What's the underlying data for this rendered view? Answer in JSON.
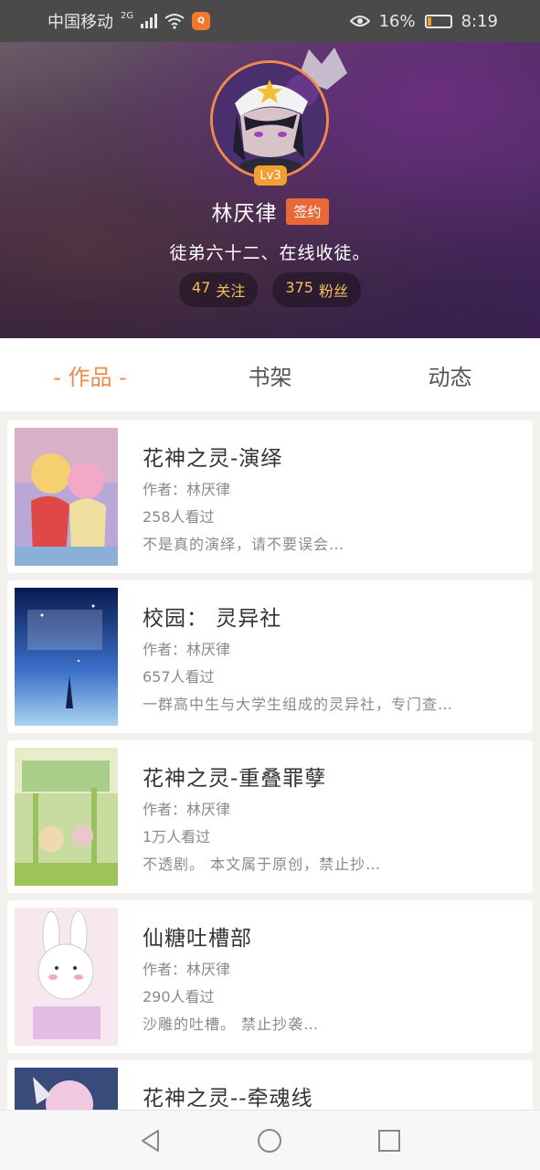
{
  "status_bar": {
    "carrier": "中国移动",
    "network": "2G",
    "battery_percent": "16%",
    "battery_level": 0.16,
    "time": "8:19"
  },
  "profile": {
    "level": "Lv3",
    "name": "林厌律",
    "sign_badge": "签约",
    "bio": "徒弟六十二、在线收徒。",
    "following_count": "47",
    "following_label": "关注",
    "fans_count": "375",
    "fans_label": "粉丝"
  },
  "tabs": [
    {
      "label": "- 作品 -",
      "active": true
    },
    {
      "label": "书架",
      "active": false
    },
    {
      "label": "动态",
      "active": false
    }
  ],
  "books": [
    {
      "title": "花神之灵-演绎",
      "author": "作者：林厌律",
      "views": "258人看过",
      "desc": "不是真的演绎，请不要误会…"
    },
    {
      "title": "校园： 灵异社",
      "author": "作者：林厌律",
      "views": "657人看过",
      "desc": "一群高中生与大学生组成的灵异社，专门查…"
    },
    {
      "title": "花神之灵-重叠罪孽",
      "author": "作者：林厌律",
      "views": "1万人看过",
      "desc": "不透剧。 本文属于原创，禁止抄…"
    },
    {
      "title": "仙糖吐槽部",
      "author": "作者：林厌律",
      "views": "290人看过",
      "desc": "沙雕的吐槽。 禁止抄袭…"
    },
    {
      "title": "花神之灵--牵魂线",
      "author": "",
      "views": "",
      "desc": ""
    }
  ],
  "colors": {
    "accent": "#f08a4a",
    "stat_text": "#f2c15a",
    "badge": "#e8683a",
    "level": "#f0a030"
  },
  "icons": {
    "eye": "eye-icon",
    "back": "back-icon",
    "home": "home-icon",
    "recents": "recents-icon"
  }
}
